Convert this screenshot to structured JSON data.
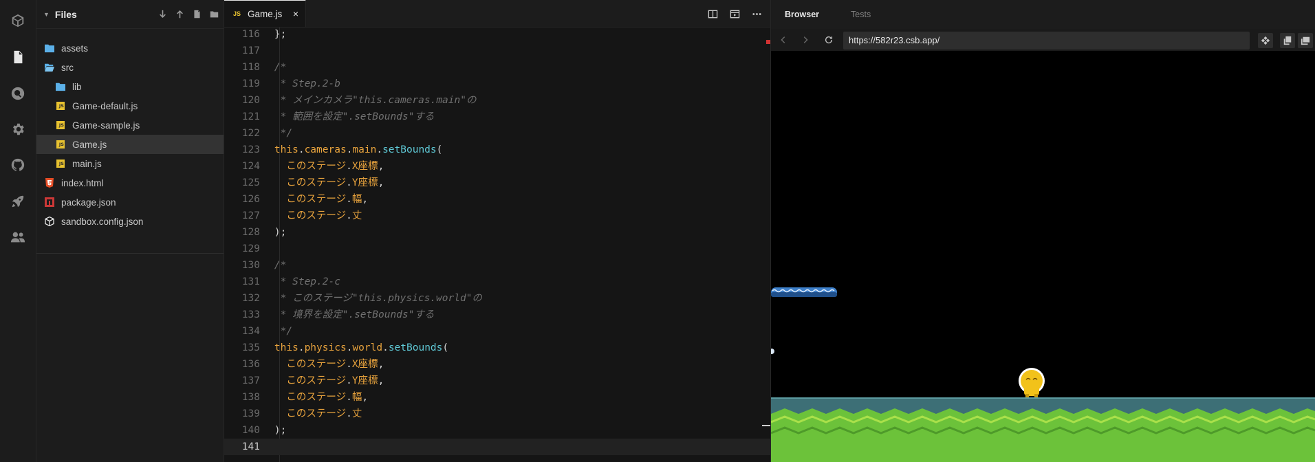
{
  "activity_bar": {
    "items": [
      {
        "icon": "cube-icon",
        "active": false
      },
      {
        "icon": "file-icon",
        "active": true
      },
      {
        "icon": "search-icon",
        "active": false
      },
      {
        "icon": "gear-icon",
        "active": false
      },
      {
        "icon": "github-icon",
        "active": false
      },
      {
        "icon": "rocket-icon",
        "active": false
      },
      {
        "icon": "people-icon",
        "active": false
      }
    ]
  },
  "explorer": {
    "title": "Files",
    "actions": [
      "download-icon",
      "upload-icon",
      "new-file-icon",
      "new-folder-icon"
    ],
    "tree": [
      {
        "name": "assets",
        "type": "folder",
        "depth": 0
      },
      {
        "name": "src",
        "type": "folder-open",
        "depth": 0
      },
      {
        "name": "lib",
        "type": "folder",
        "depth": 1
      },
      {
        "name": "Game-default.js",
        "type": "js",
        "depth": 1
      },
      {
        "name": "Game-sample.js",
        "type": "js",
        "depth": 1
      },
      {
        "name": "Game.js",
        "type": "js",
        "depth": 1,
        "selected": true
      },
      {
        "name": "main.js",
        "type": "js",
        "depth": 1
      },
      {
        "name": "index.html",
        "type": "html",
        "depth": 0
      },
      {
        "name": "package.json",
        "type": "npm",
        "depth": 0
      },
      {
        "name": "sandbox.config.json",
        "type": "box",
        "depth": 0
      }
    ]
  },
  "editor": {
    "tab": {
      "badge": "JS",
      "label": "Game.js",
      "close": "×"
    },
    "current_line": 141,
    "lines": [
      {
        "n": "116",
        "tokens": [
          [
            "pl",
            "    };"
          ]
        ]
      },
      {
        "n": "117",
        "tokens": []
      },
      {
        "n": "118",
        "tokens": [
          [
            "cmt",
            "    /*"
          ]
        ]
      },
      {
        "n": "119",
        "tokens": [
          [
            "cmt",
            "     * Step.2-b"
          ]
        ]
      },
      {
        "n": "120",
        "tokens": [
          [
            "cmt",
            "     * メインカメラ\"this.cameras.main\"の"
          ]
        ]
      },
      {
        "n": "121",
        "tokens": [
          [
            "cmt",
            "     * 範囲を設定\".setBounds\"する"
          ]
        ]
      },
      {
        "n": "122",
        "tokens": [
          [
            "cmt",
            "     */"
          ]
        ]
      },
      {
        "n": "123",
        "tokens": [
          [
            "kw",
            "    this"
          ],
          [
            "pl",
            "."
          ],
          [
            "pr",
            "cameras"
          ],
          [
            "pl",
            "."
          ],
          [
            "pr",
            "main"
          ],
          [
            "pl",
            "."
          ],
          [
            "fn",
            "setBounds"
          ],
          [
            "pl",
            "("
          ]
        ]
      },
      {
        "n": "124",
        "tokens": [
          [
            "pr",
            "      このステージ"
          ],
          [
            "pl",
            "."
          ],
          [
            "pr",
            "X座標"
          ],
          [
            "pl",
            ","
          ]
        ]
      },
      {
        "n": "125",
        "tokens": [
          [
            "pr",
            "      このステージ"
          ],
          [
            "pl",
            "."
          ],
          [
            "pr",
            "Y座標"
          ],
          [
            "pl",
            ","
          ]
        ]
      },
      {
        "n": "126",
        "tokens": [
          [
            "pr",
            "      このステージ"
          ],
          [
            "pl",
            "."
          ],
          [
            "pr",
            "幅"
          ],
          [
            "pl",
            ","
          ]
        ]
      },
      {
        "n": "127",
        "tokens": [
          [
            "pr",
            "      このステージ"
          ],
          [
            "pl",
            "."
          ],
          [
            "pr",
            "丈"
          ]
        ]
      },
      {
        "n": "128",
        "tokens": [
          [
            "pl",
            "    );"
          ]
        ]
      },
      {
        "n": "129",
        "tokens": []
      },
      {
        "n": "130",
        "tokens": [
          [
            "cmt",
            "    /*"
          ]
        ]
      },
      {
        "n": "131",
        "tokens": [
          [
            "cmt",
            "     * Step.2-c"
          ]
        ]
      },
      {
        "n": "132",
        "tokens": [
          [
            "cmt",
            "     * このステージ\"this.physics.world\"の"
          ]
        ]
      },
      {
        "n": "133",
        "tokens": [
          [
            "cmt",
            "     * 境界を設定\".setBounds\"する"
          ]
        ]
      },
      {
        "n": "134",
        "tokens": [
          [
            "cmt",
            "     */"
          ]
        ]
      },
      {
        "n": "135",
        "tokens": [
          [
            "kw",
            "    this"
          ],
          [
            "pl",
            "."
          ],
          [
            "pr",
            "physics"
          ],
          [
            "pl",
            "."
          ],
          [
            "pr",
            "world"
          ],
          [
            "pl",
            "."
          ],
          [
            "fn",
            "setBounds"
          ],
          [
            "pl",
            "("
          ]
        ]
      },
      {
        "n": "136",
        "tokens": [
          [
            "pr",
            "      このステージ"
          ],
          [
            "pl",
            "."
          ],
          [
            "pr",
            "X座標"
          ],
          [
            "pl",
            ","
          ]
        ]
      },
      {
        "n": "137",
        "tokens": [
          [
            "pr",
            "      このステージ"
          ],
          [
            "pl",
            "."
          ],
          [
            "pr",
            "Y座標"
          ],
          [
            "pl",
            ","
          ]
        ]
      },
      {
        "n": "138",
        "tokens": [
          [
            "pr",
            "      このステージ"
          ],
          [
            "pl",
            "."
          ],
          [
            "pr",
            "幅"
          ],
          [
            "pl",
            ","
          ]
        ]
      },
      {
        "n": "139",
        "tokens": [
          [
            "pr",
            "      このステージ"
          ],
          [
            "pl",
            "."
          ],
          [
            "pr",
            "丈"
          ]
        ]
      },
      {
        "n": "140",
        "tokens": [
          [
            "pl",
            "    );"
          ]
        ]
      },
      {
        "n": "141",
        "tokens": []
      }
    ]
  },
  "preview": {
    "tabs": [
      {
        "label": "Browser",
        "active": true
      },
      {
        "label": "Tests",
        "active": false
      }
    ],
    "url": "https://582r23.csb.app/"
  },
  "colors": {
    "accent_js": "#e8c230",
    "game_ground_green": "#6cc23a",
    "game_ground_teal": "#3d6f76",
    "player_yellow": "#f2c21a"
  }
}
